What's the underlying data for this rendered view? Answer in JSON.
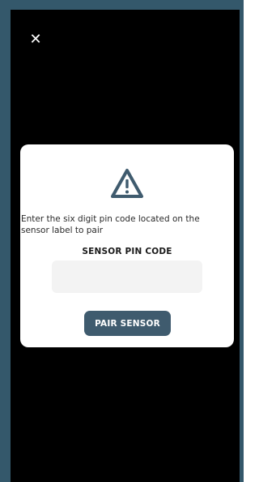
{
  "header": {
    "close_icon": "close-icon",
    "close_glyph": "✕"
  },
  "modal": {
    "icon": "warning-icon",
    "message": "Enter the six digit pin code located on the sensor label to pair",
    "pin_label": "SENSOR PIN CODE",
    "pin_value": "",
    "pin_placeholder": "",
    "pair_button_label": "PAIR SENSOR"
  },
  "colors": {
    "frame": "#34586b",
    "screen": "#000000",
    "modal_bg": "#ffffff",
    "accent": "#3f5b6e",
    "input_bg": "#f3f3f3"
  }
}
